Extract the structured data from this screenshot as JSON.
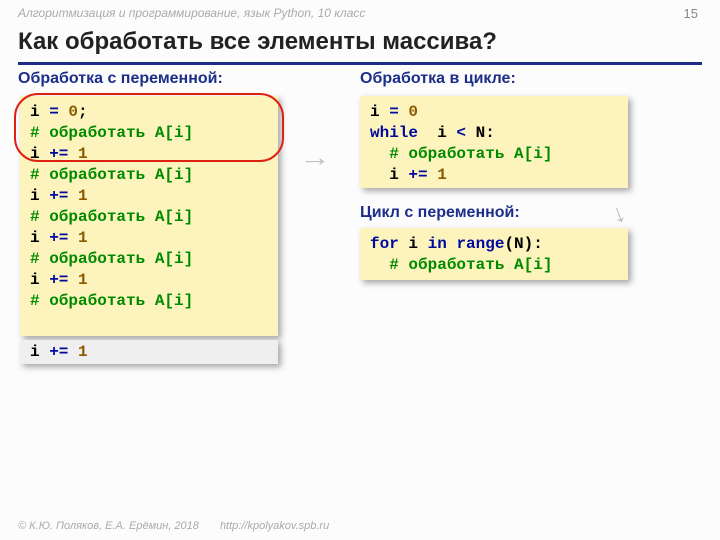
{
  "breadcrumb": "Алгоритмизация и программирование, язык Python, 10 класс",
  "page_number": "15",
  "title": "Как обработать все элементы массива?",
  "sub_left": "Обработка с переменной:",
  "sub_right1": "Обработка в цикле:",
  "sub_right2": "Цикл с переменной:",
  "left_code_tokens": [
    {
      "t": "i ",
      "c": ""
    },
    {
      "t": "=",
      "c": "kw-navy"
    },
    {
      "t": " ",
      "c": ""
    },
    {
      "t": "0",
      "c": "kw-brown"
    },
    {
      "t": ";\n",
      "c": ""
    },
    {
      "t": "# обработать A[i]\n",
      "c": "kw-green"
    },
    {
      "t": "i ",
      "c": ""
    },
    {
      "t": "+=",
      "c": "kw-navy"
    },
    {
      "t": " ",
      "c": ""
    },
    {
      "t": "1",
      "c": "kw-brown"
    },
    {
      "t": "\n",
      "c": ""
    },
    {
      "t": "# обработать A[i]\n",
      "c": "kw-green"
    },
    {
      "t": "i ",
      "c": ""
    },
    {
      "t": "+=",
      "c": "kw-navy"
    },
    {
      "t": " ",
      "c": ""
    },
    {
      "t": "1",
      "c": "kw-brown"
    },
    {
      "t": "\n",
      "c": ""
    },
    {
      "t": "# обработать A[i]\n",
      "c": "kw-green"
    },
    {
      "t": "i ",
      "c": ""
    },
    {
      "t": "+=",
      "c": "kw-navy"
    },
    {
      "t": " ",
      "c": ""
    },
    {
      "t": "1",
      "c": "kw-brown"
    },
    {
      "t": "\n",
      "c": ""
    },
    {
      "t": "# обработать A[i]\n",
      "c": "kw-green"
    },
    {
      "t": "i ",
      "c": ""
    },
    {
      "t": "+=",
      "c": "kw-navy"
    },
    {
      "t": " ",
      "c": ""
    },
    {
      "t": "1",
      "c": "kw-brown"
    },
    {
      "t": "\n",
      "c": ""
    },
    {
      "t": "# обработать A[i]",
      "c": "kw-green"
    }
  ],
  "left_extra_tokens": [
    {
      "t": "i ",
      "c": ""
    },
    {
      "t": "+=",
      "c": "kw-navy"
    },
    {
      "t": " ",
      "c": ""
    },
    {
      "t": "1",
      "c": "kw-brown"
    }
  ],
  "r1_code_tokens": [
    {
      "t": "i ",
      "c": ""
    },
    {
      "t": "=",
      "c": "kw-navy"
    },
    {
      "t": " ",
      "c": ""
    },
    {
      "t": "0",
      "c": "kw-brown"
    },
    {
      "t": "\n",
      "c": ""
    },
    {
      "t": "while",
      "c": "kw-navy"
    },
    {
      "t": "  i ",
      "c": ""
    },
    {
      "t": "<",
      "c": "kw-navy"
    },
    {
      "t": " N:\n",
      "c": ""
    },
    {
      "t": "  ",
      "c": ""
    },
    {
      "t": "# обработать A[i]\n",
      "c": "kw-green"
    },
    {
      "t": "  i ",
      "c": ""
    },
    {
      "t": "+=",
      "c": "kw-navy"
    },
    {
      "t": " ",
      "c": ""
    },
    {
      "t": "1",
      "c": "kw-brown"
    }
  ],
  "r2_code_tokens": [
    {
      "t": "for",
      "c": "kw-navy"
    },
    {
      "t": " i ",
      "c": ""
    },
    {
      "t": "in",
      "c": "kw-navy"
    },
    {
      "t": " ",
      "c": ""
    },
    {
      "t": "range",
      "c": "kw-navy"
    },
    {
      "t": "(N):\n",
      "c": ""
    },
    {
      "t": "  ",
      "c": ""
    },
    {
      "t": "# обработать A[i]",
      "c": "kw-green"
    }
  ],
  "arrows": {
    "a1": "→",
    "a2": "→"
  },
  "footer_left": "© К.Ю. Поляков, Е.А. Ерёмин, 2018",
  "footer_right": "http://kpolyakov.spb.ru"
}
